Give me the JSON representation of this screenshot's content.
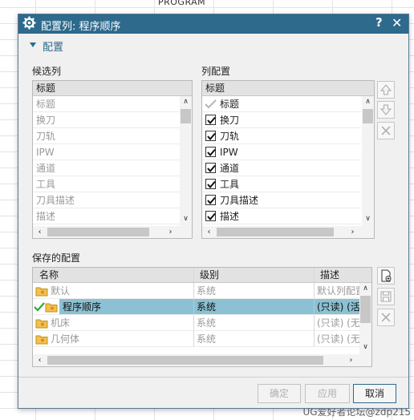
{
  "background": {
    "program_label": "PROGRAM",
    "watermark": "UG爱好者论坛@zdp215"
  },
  "dialog": {
    "title": "配置列: 程序顺序",
    "help_label": "?",
    "close_label": "✕"
  },
  "section": {
    "title": "配置"
  },
  "candidates": {
    "label": "候选列",
    "header": "标题",
    "items": [
      "标题",
      "换刀",
      "刀轨",
      "IPW",
      "通道",
      "工具",
      "刀具描述",
      "描述"
    ]
  },
  "column_config": {
    "label": "列配置",
    "header": "标题",
    "items": [
      {
        "label": "标题",
        "state": "disabled"
      },
      {
        "label": "换刀",
        "state": "checked"
      },
      {
        "label": "刀轨",
        "state": "checked"
      },
      {
        "label": "IPW",
        "state": "checked"
      },
      {
        "label": "通道",
        "state": "checked"
      },
      {
        "label": "工具",
        "state": "checked"
      },
      {
        "label": "刀具描述",
        "state": "checked"
      },
      {
        "label": "描述",
        "state": "checked"
      }
    ]
  },
  "saved_configs": {
    "label": "保存的配置",
    "headers": [
      "名称",
      "级别",
      "描述"
    ],
    "rows": [
      {
        "name": "默认",
        "level": "系统",
        "desc": "默认列配置",
        "active": false,
        "selected": false
      },
      {
        "name": "程序顺序",
        "level": "系统",
        "desc": "(只读) (活",
        "active": true,
        "selected": true
      },
      {
        "name": "机床",
        "level": "系统",
        "desc": "(只读) (无",
        "active": false,
        "selected": false
      },
      {
        "name": "几何体",
        "level": "系统",
        "desc": "(只读) (无",
        "active": false,
        "selected": false
      }
    ]
  },
  "buttons": {
    "ok": "确定",
    "apply": "应用",
    "cancel": "取消"
  },
  "colors": {
    "titlebar": "#2d6a8c",
    "selection": "#8cc1d3",
    "accent": "#2d6a8c"
  }
}
